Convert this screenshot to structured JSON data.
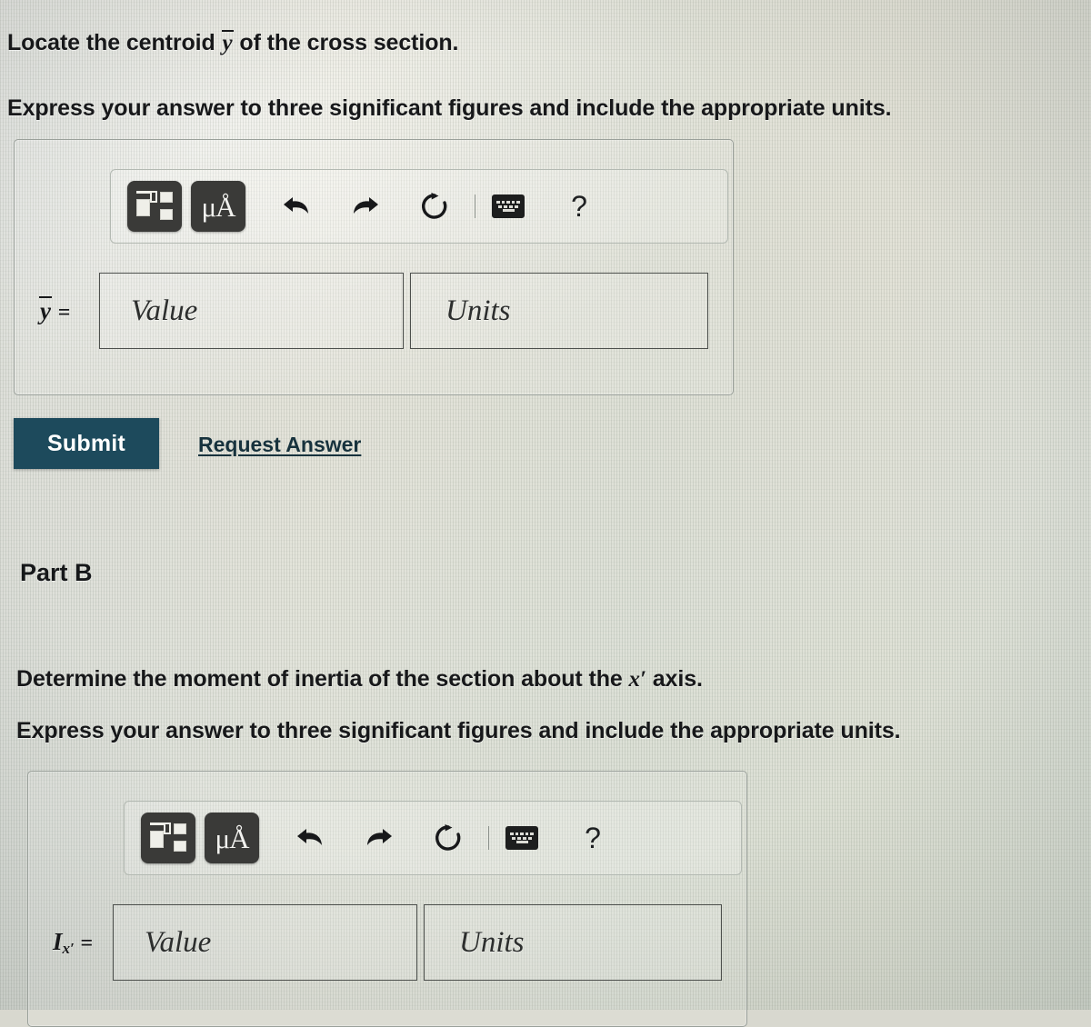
{
  "part_a": {
    "prompt_line1_prefix": "Locate the centroid ",
    "prompt_line1_var": "y",
    "prompt_line1_suffix": " of the cross section.",
    "prompt_line2": "Express your answer to three significant figures and include the appropriate units.",
    "answer_label_var": "y",
    "answer_label_eq": "=",
    "value_placeholder": "Value",
    "units_placeholder": "Units",
    "submit_label": "Submit",
    "request_answer_label": "Request Answer"
  },
  "part_b": {
    "heading": "Part B",
    "prompt_line1_prefix": "Determine the moment of inertia of the section about the ",
    "prompt_line1_var": "x′",
    "prompt_line1_suffix": " axis.",
    "prompt_line2": "Express your answer to three significant figures and include the appropriate units.",
    "answer_label_var": "I",
    "answer_label_sub": "x′",
    "answer_label_eq": "=",
    "value_placeholder": "Value",
    "units_placeholder": "Units"
  },
  "toolbar": {
    "template_button_name": "math-template",
    "units_button_label": "μÅ",
    "units_button_mu": "μ",
    "units_button_angstrom": "Å",
    "undo_label": "undo",
    "redo_label": "redo",
    "reset_label": "reset",
    "keyboard_label": "keyboard shortcuts",
    "help_label": "?"
  },
  "colors": {
    "submit_background": "#1d4a5c",
    "submit_text": "#ffffff",
    "link_text": "#17323d",
    "toolbar_button": "#3a3a38",
    "page_background": "#dcdcd2",
    "text": "#17181a"
  }
}
